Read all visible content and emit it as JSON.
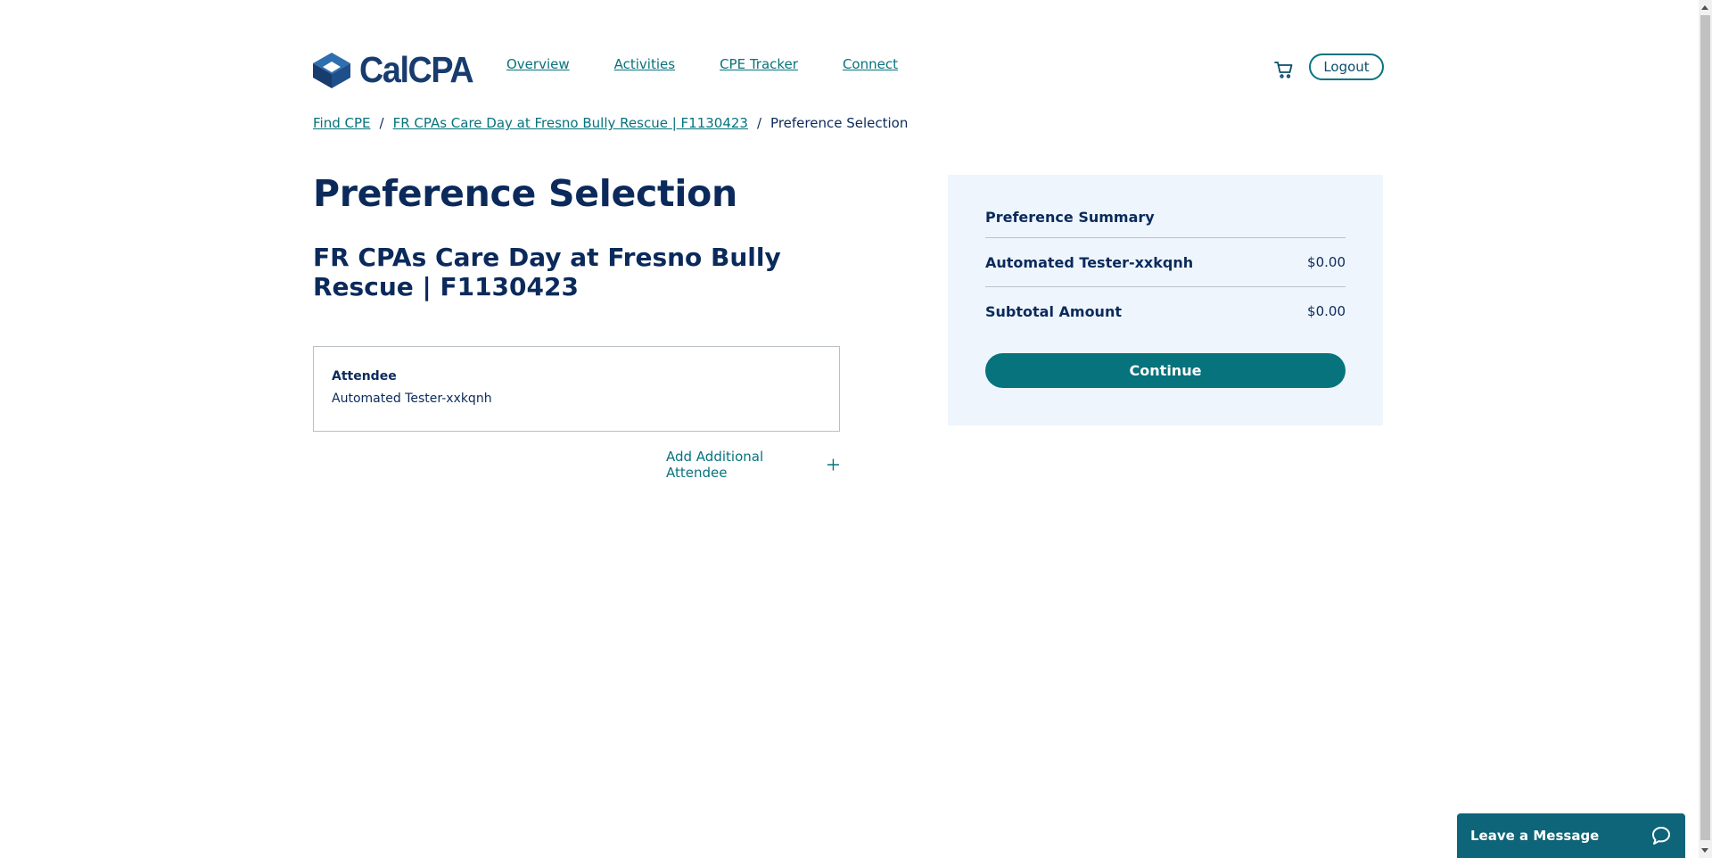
{
  "brand": {
    "name": "CalCPA"
  },
  "nav": {
    "items": [
      {
        "label": "Overview"
      },
      {
        "label": "Activities"
      },
      {
        "label": "CPE Tracker"
      },
      {
        "label": "Connect"
      }
    ],
    "cart_icon": "cart-icon",
    "logout_label": "Logout"
  },
  "breadcrumb": {
    "items": [
      {
        "label": "Find CPE"
      },
      {
        "label": "FR CPAs Care Day at Fresno Bully Rescue | F1130423"
      },
      {
        "label": "Preference Selection"
      }
    ],
    "separator": "/"
  },
  "page": {
    "title": "Preference Selection",
    "event_title": "FR CPAs Care Day at Fresno Bully Rescue | F1130423"
  },
  "attendee": {
    "label": "Attendee",
    "name": "Automated Tester-xxkqnh"
  },
  "add_attendee": {
    "label": "Add Additional Attendee",
    "icon": "plus-icon"
  },
  "summary": {
    "title": "Preference Summary",
    "line_items": [
      {
        "name": "Automated Tester-xxkqnh",
        "amount": "$0.00"
      }
    ],
    "subtotal_label": "Subtotal Amount",
    "subtotal_amount": "$0.00",
    "continue_label": "Continue"
  },
  "chat": {
    "label": "Leave a Message",
    "icon": "chat-bubble-icon"
  },
  "colors": {
    "primary_teal": "#06737d",
    "navy_text": "#0b2a5b",
    "summary_bg": "#eef5fd",
    "chat_bg": "#0e6478"
  }
}
